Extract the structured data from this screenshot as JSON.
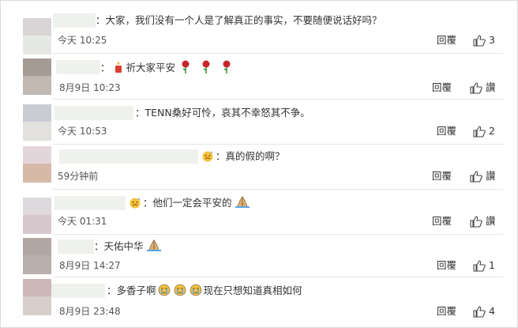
{
  "comments": [
    {
      "text": "：大家，我们没有一个人是了解真正的事实，不要随便说话好吗？",
      "time": "今天 10:25",
      "reply": "回覆",
      "likes": "3"
    },
    {
      "text_before": "：",
      "text_after": "祈大家平安",
      "time": "8月9日 10:23",
      "reply": "回覆",
      "likes": "讚"
    },
    {
      "text": "：TENN桑好可怜，哀其不幸怒其不争。",
      "time": "今天 10:53",
      "reply": "回覆",
      "likes": "2"
    },
    {
      "text": "：真的假的啊？",
      "time": "59分钟前",
      "reply": "回覆",
      "likes": "讚"
    },
    {
      "text_before": "：他们一定会平安的",
      "time": "今天 01:31",
      "reply": "回覆",
      "likes": "讚"
    },
    {
      "text_before": "：天佑中华",
      "time": "8月9日 14:27",
      "reply": "回覆",
      "likes": "1"
    },
    {
      "text_before": "：多香子啊",
      "text_after": "现在只想知道真相如何",
      "time": "8月9日 23:48",
      "reply": "回覆",
      "likes": "4"
    }
  ],
  "colors": {
    "avatars": [
      [
        "#d9d4d6",
        "#e6e8e4"
      ],
      [
        "#a69b93",
        "#c0b8b1"
      ],
      [
        "#c9cdd2",
        "#e3e1de"
      ],
      [
        "#e2d6da",
        "#d7b9a8"
      ],
      [
        "#ded9dc",
        "#d6c8cc"
      ],
      [
        "#b2a6a3",
        "#b9b0ae"
      ],
      [
        "#cdb7b8",
        "#d8cfcd"
      ]
    ]
  },
  "icons": {
    "like": "thumbs-up-icon",
    "rose": "rose-icon",
    "pray": "pray-icon",
    "sweat": "sweat-face-icon",
    "cry": "crying-face-icon",
    "candle": "candle-icon"
  }
}
